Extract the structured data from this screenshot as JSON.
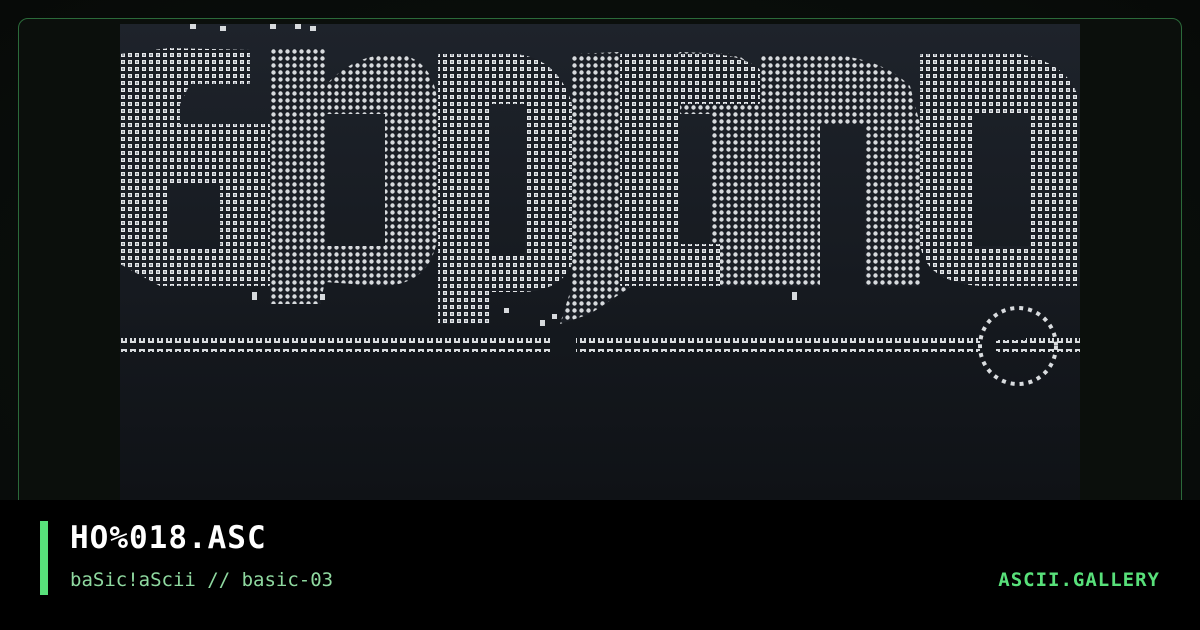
{
  "card": {
    "title": "HO%018.ASC",
    "subtitle": "baSic!aScii // basic-03",
    "brand": "ASCII.GALLERY"
  },
  "colors": {
    "accent": "#58e07a",
    "subtitle": "#8fd9a0",
    "frame_border": "#2b6a3a",
    "art_background": "#1b1f26",
    "ascii_glyph": "#e6e8ea"
  },
  "art": {
    "kind": "ascii-art",
    "glyph_texture": "@#%*+=:.-"
  }
}
